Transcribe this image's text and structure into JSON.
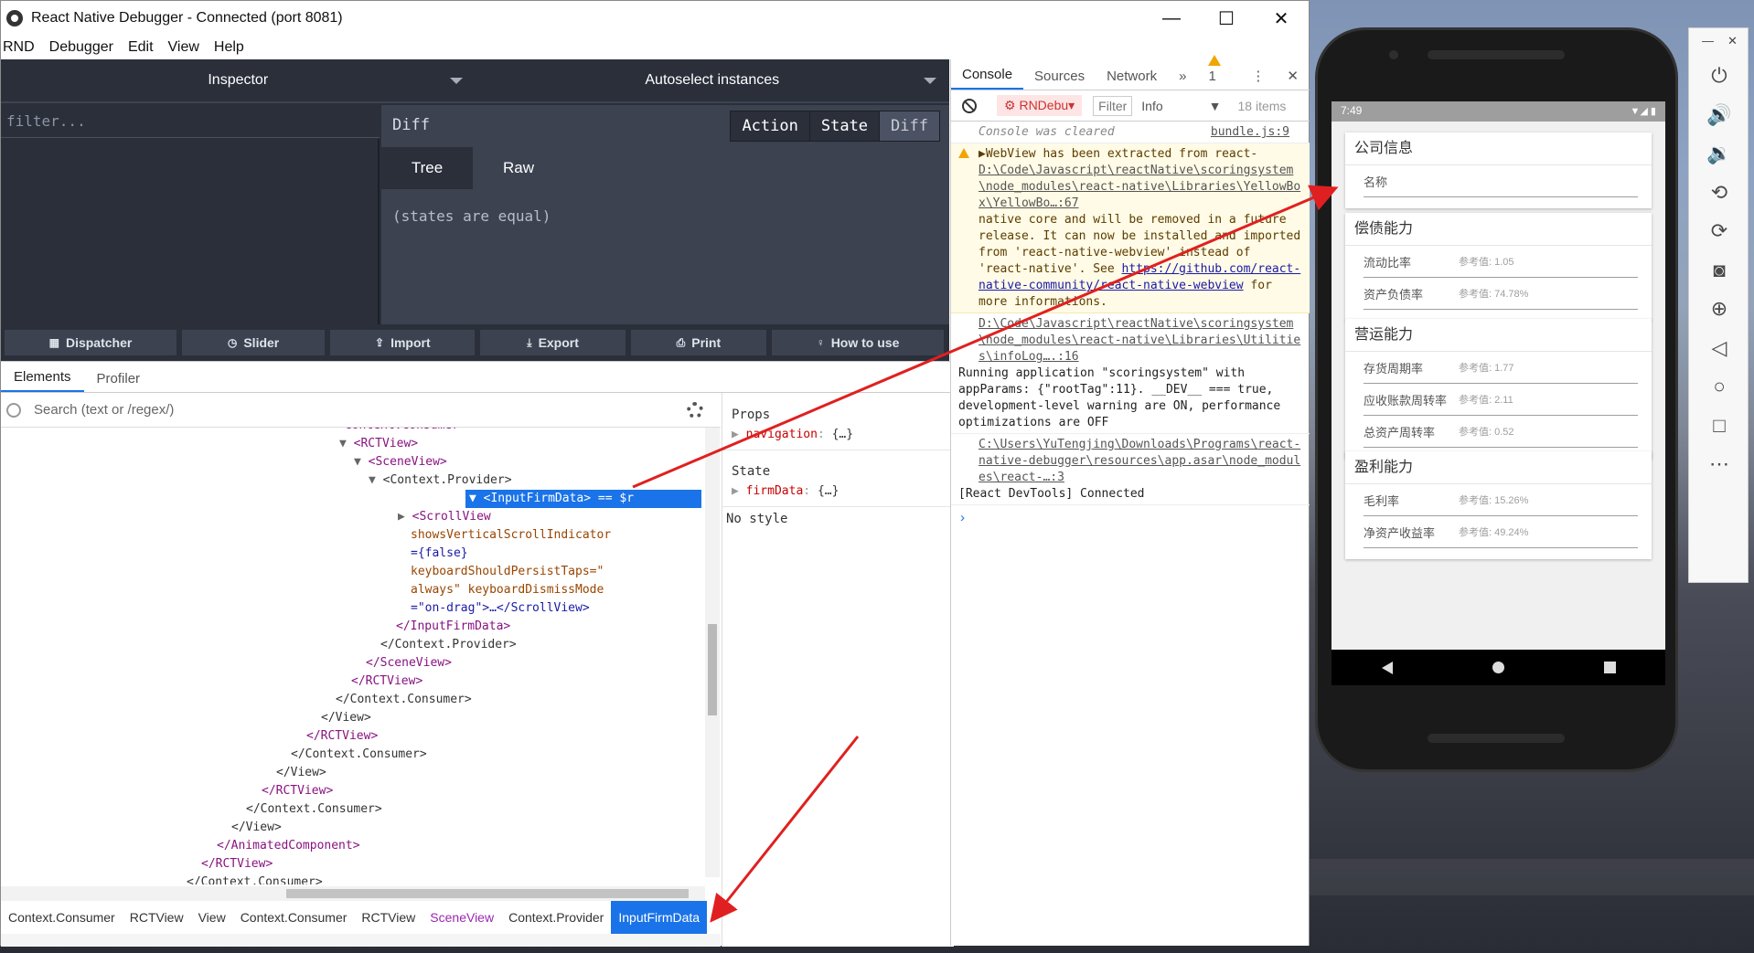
{
  "window": {
    "title": "React Native Debugger - Connected (port 8081)",
    "minimize": "—",
    "maximize": "☐",
    "close": "✕"
  },
  "menu": [
    "RND",
    "Debugger",
    "Edit",
    "View",
    "Help"
  ],
  "monitor": {
    "inspector_label": "Inspector",
    "instance_label": "Autoselect instances",
    "filter_placeholder": "filter...",
    "diff_title": "Diff",
    "buttons": [
      "Action",
      "State",
      "Diff"
    ],
    "subtabs": [
      "Tree",
      "Raw"
    ],
    "states_equal": "(states are equal)"
  },
  "toolbar": [
    {
      "label": "Dispatcher",
      "icon": "keyboard-icon",
      "glyph": "▦"
    },
    {
      "label": "Slider",
      "icon": "clock-icon",
      "glyph": "◷"
    },
    {
      "label": "Import",
      "icon": "upload-icon",
      "glyph": "⇪"
    },
    {
      "label": "Export",
      "icon": "download-icon",
      "glyph": "⤓"
    },
    {
      "label": "Print",
      "icon": "print-icon",
      "glyph": "⎙"
    },
    {
      "label": "How to use",
      "icon": "bulb-icon",
      "glyph": "♀"
    }
  ],
  "elements": {
    "tabs": [
      "Elements",
      "Profiler"
    ],
    "search_placeholder": "Search (text or /regex/)",
    "tree": [
      {
        "indent": 368,
        "text": "<Context.Consumer>",
        "cls": "tag"
      },
      {
        "indent": 370,
        "arrow": "▼",
        "text": "<RCTView>",
        "cls": "tag"
      },
      {
        "indent": 386,
        "arrow": "▼",
        "text": "<SceneView>",
        "cls": "tag"
      },
      {
        "indent": 402,
        "arrow": "▼",
        "text": "<Context.Provider>",
        "cls": "plain"
      },
      {
        "indent": 418,
        "arrow": "▼",
        "text": "<InputFirmData> == $r",
        "cls": "sel"
      },
      {
        "indent": 434,
        "arrow": "▶",
        "text": "<ScrollView",
        "cls": "tag"
      },
      {
        "indent": 448,
        "text": "showsVerticalScrollIndicator",
        "cls": "attr"
      },
      {
        "indent": 448,
        "text": "={false}",
        "cls": "val"
      },
      {
        "indent": 448,
        "text": "keyboardShouldPersistTaps=\"",
        "cls": "attr"
      },
      {
        "indent": 448,
        "text": "always\" keyboardDismissMode",
        "cls": "attr"
      },
      {
        "indent": 448,
        "text": "=\"on-drag\">…</ScrollView>",
        "cls": "val"
      },
      {
        "indent": 432,
        "text": "</InputFirmData>",
        "cls": "tag"
      },
      {
        "indent": 415,
        "text": "</Context.Provider>",
        "cls": "plain"
      },
      {
        "indent": 399,
        "text": "</SceneView>",
        "cls": "tag"
      },
      {
        "indent": 383,
        "text": "</RCTView>",
        "cls": "tag"
      },
      {
        "indent": 366,
        "text": "</Context.Consumer>",
        "cls": "plain"
      },
      {
        "indent": 350,
        "text": "</View>",
        "cls": "plain"
      },
      {
        "indent": 334,
        "text": "</RCTView>",
        "cls": "tag"
      },
      {
        "indent": 317,
        "text": "</Context.Consumer>",
        "cls": "plain"
      },
      {
        "indent": 301,
        "text": "</View>",
        "cls": "plain"
      },
      {
        "indent": 285,
        "text": "</RCTView>",
        "cls": "tag"
      },
      {
        "indent": 268,
        "text": "</Context.Consumer>",
        "cls": "plain"
      },
      {
        "indent": 252,
        "text": "</View>",
        "cls": "plain"
      },
      {
        "indent": 236,
        "text": "</AnimatedComponent>",
        "cls": "tag"
      },
      {
        "indent": 219,
        "text": "</RCTView>",
        "cls": "tag"
      },
      {
        "indent": 203,
        "text": "</Context.Consumer>",
        "cls": "plain"
      }
    ],
    "breadcrumbs": [
      "Context.Consumer",
      "RCTView",
      "View",
      "Context.Consumer",
      "RCTView",
      "SceneView",
      "Context.Provider",
      "InputFirmData"
    ],
    "props_title": "Props",
    "props_key": "navigation",
    "props_val": "{…}",
    "state_title": "State",
    "state_key": "firmData",
    "state_val": "{…}",
    "no_style": "No style"
  },
  "console": {
    "tabs": [
      "Console",
      "Sources",
      "Network"
    ],
    "more": "»",
    "warn_count": "1",
    "context": "RNDebu▾",
    "filter_placeholder": "Filter",
    "level": "Info",
    "items": "18 items",
    "cleared": "Console was cleared",
    "cleared_src": "bundle.js:9",
    "warn_text1": "▶WebView has been extracted from react-",
    "warn_src": "D:\\Code\\Javascript\\reactNative\\scoringsystem\\node_modules\\react-native\\Libraries\\YellowBox\\YellowBo…:67",
    "warn_text2": "native core and will be removed in a future release. It can now be installed and imported from 'react-native-webview' instead of 'react-native'. See",
    "warn_link": "https://github.com/react-native-community/react-native-webview",
    "warn_text3": "for more informations.",
    "info_src": "D:\\Code\\Javascript\\reactNative\\scoringsystem\\node_modules\\react-native\\Libraries\\Utilities\\infoLog….:16",
    "info_text": "Running application \"scoringsystem\" with appParams: {\"rootTag\":11}. __DEV__ === true, development-level warning are ON, performance optimizations are OFF",
    "dev_src": "C:\\Users\\YuTengjing\\Downloads\\Programs\\react-native-debugger\\resources\\app.asar\\node_modules\\react-…:3",
    "dev_text": "[React DevTools] Connected",
    "prompt": "›"
  },
  "phone": {
    "time": "7:49",
    "status_icons": "▼◢ ▮",
    "cards": [
      {
        "title": "公司信息",
        "rows": [
          {
            "label": "名称",
            "ref": ""
          }
        ]
      },
      {
        "title": "偿债能力",
        "rows": [
          {
            "label": "流动比率",
            "ref": "参考值: 1.05"
          },
          {
            "label": "资产负债率",
            "ref": "参考值: 74.78%"
          }
        ]
      },
      {
        "title": "营运能力",
        "rows": [
          {
            "label": "存货周期率",
            "ref": "参考值: 1.77"
          },
          {
            "label": "应收账款周转率",
            "ref": "参考值: 2.11"
          },
          {
            "label": "总资产周转率",
            "ref": "参考值: 0.52"
          }
        ]
      },
      {
        "title": "盈利能力",
        "rows": [
          {
            "label": "毛利率",
            "ref": "参考值: 15.26%"
          },
          {
            "label": "净资产收益率",
            "ref": "参考值: 49.24%"
          }
        ]
      }
    ]
  },
  "emulator": {
    "minimize": "—",
    "close": "✕",
    "buttons": [
      {
        "name": "power-icon",
        "glyph": "⏻"
      },
      {
        "name": "volume-up-icon",
        "glyph": "🔊"
      },
      {
        "name": "volume-down-icon",
        "glyph": "🔉"
      },
      {
        "name": "rotate-left-icon",
        "glyph": "⟲"
      },
      {
        "name": "rotate-right-icon",
        "glyph": "⟳"
      },
      {
        "name": "camera-icon",
        "glyph": "◙"
      },
      {
        "name": "zoom-icon",
        "glyph": "⊕"
      },
      {
        "name": "back-icon",
        "glyph": "◁"
      },
      {
        "name": "home-icon",
        "glyph": "○"
      },
      {
        "name": "overview-icon",
        "glyph": "□"
      },
      {
        "name": "more-icon",
        "glyph": "⋯"
      }
    ]
  },
  "colors": {
    "accent": "#1a73e8",
    "arrow": "#e02020",
    "dark_panel": "#2a2f3a"
  }
}
